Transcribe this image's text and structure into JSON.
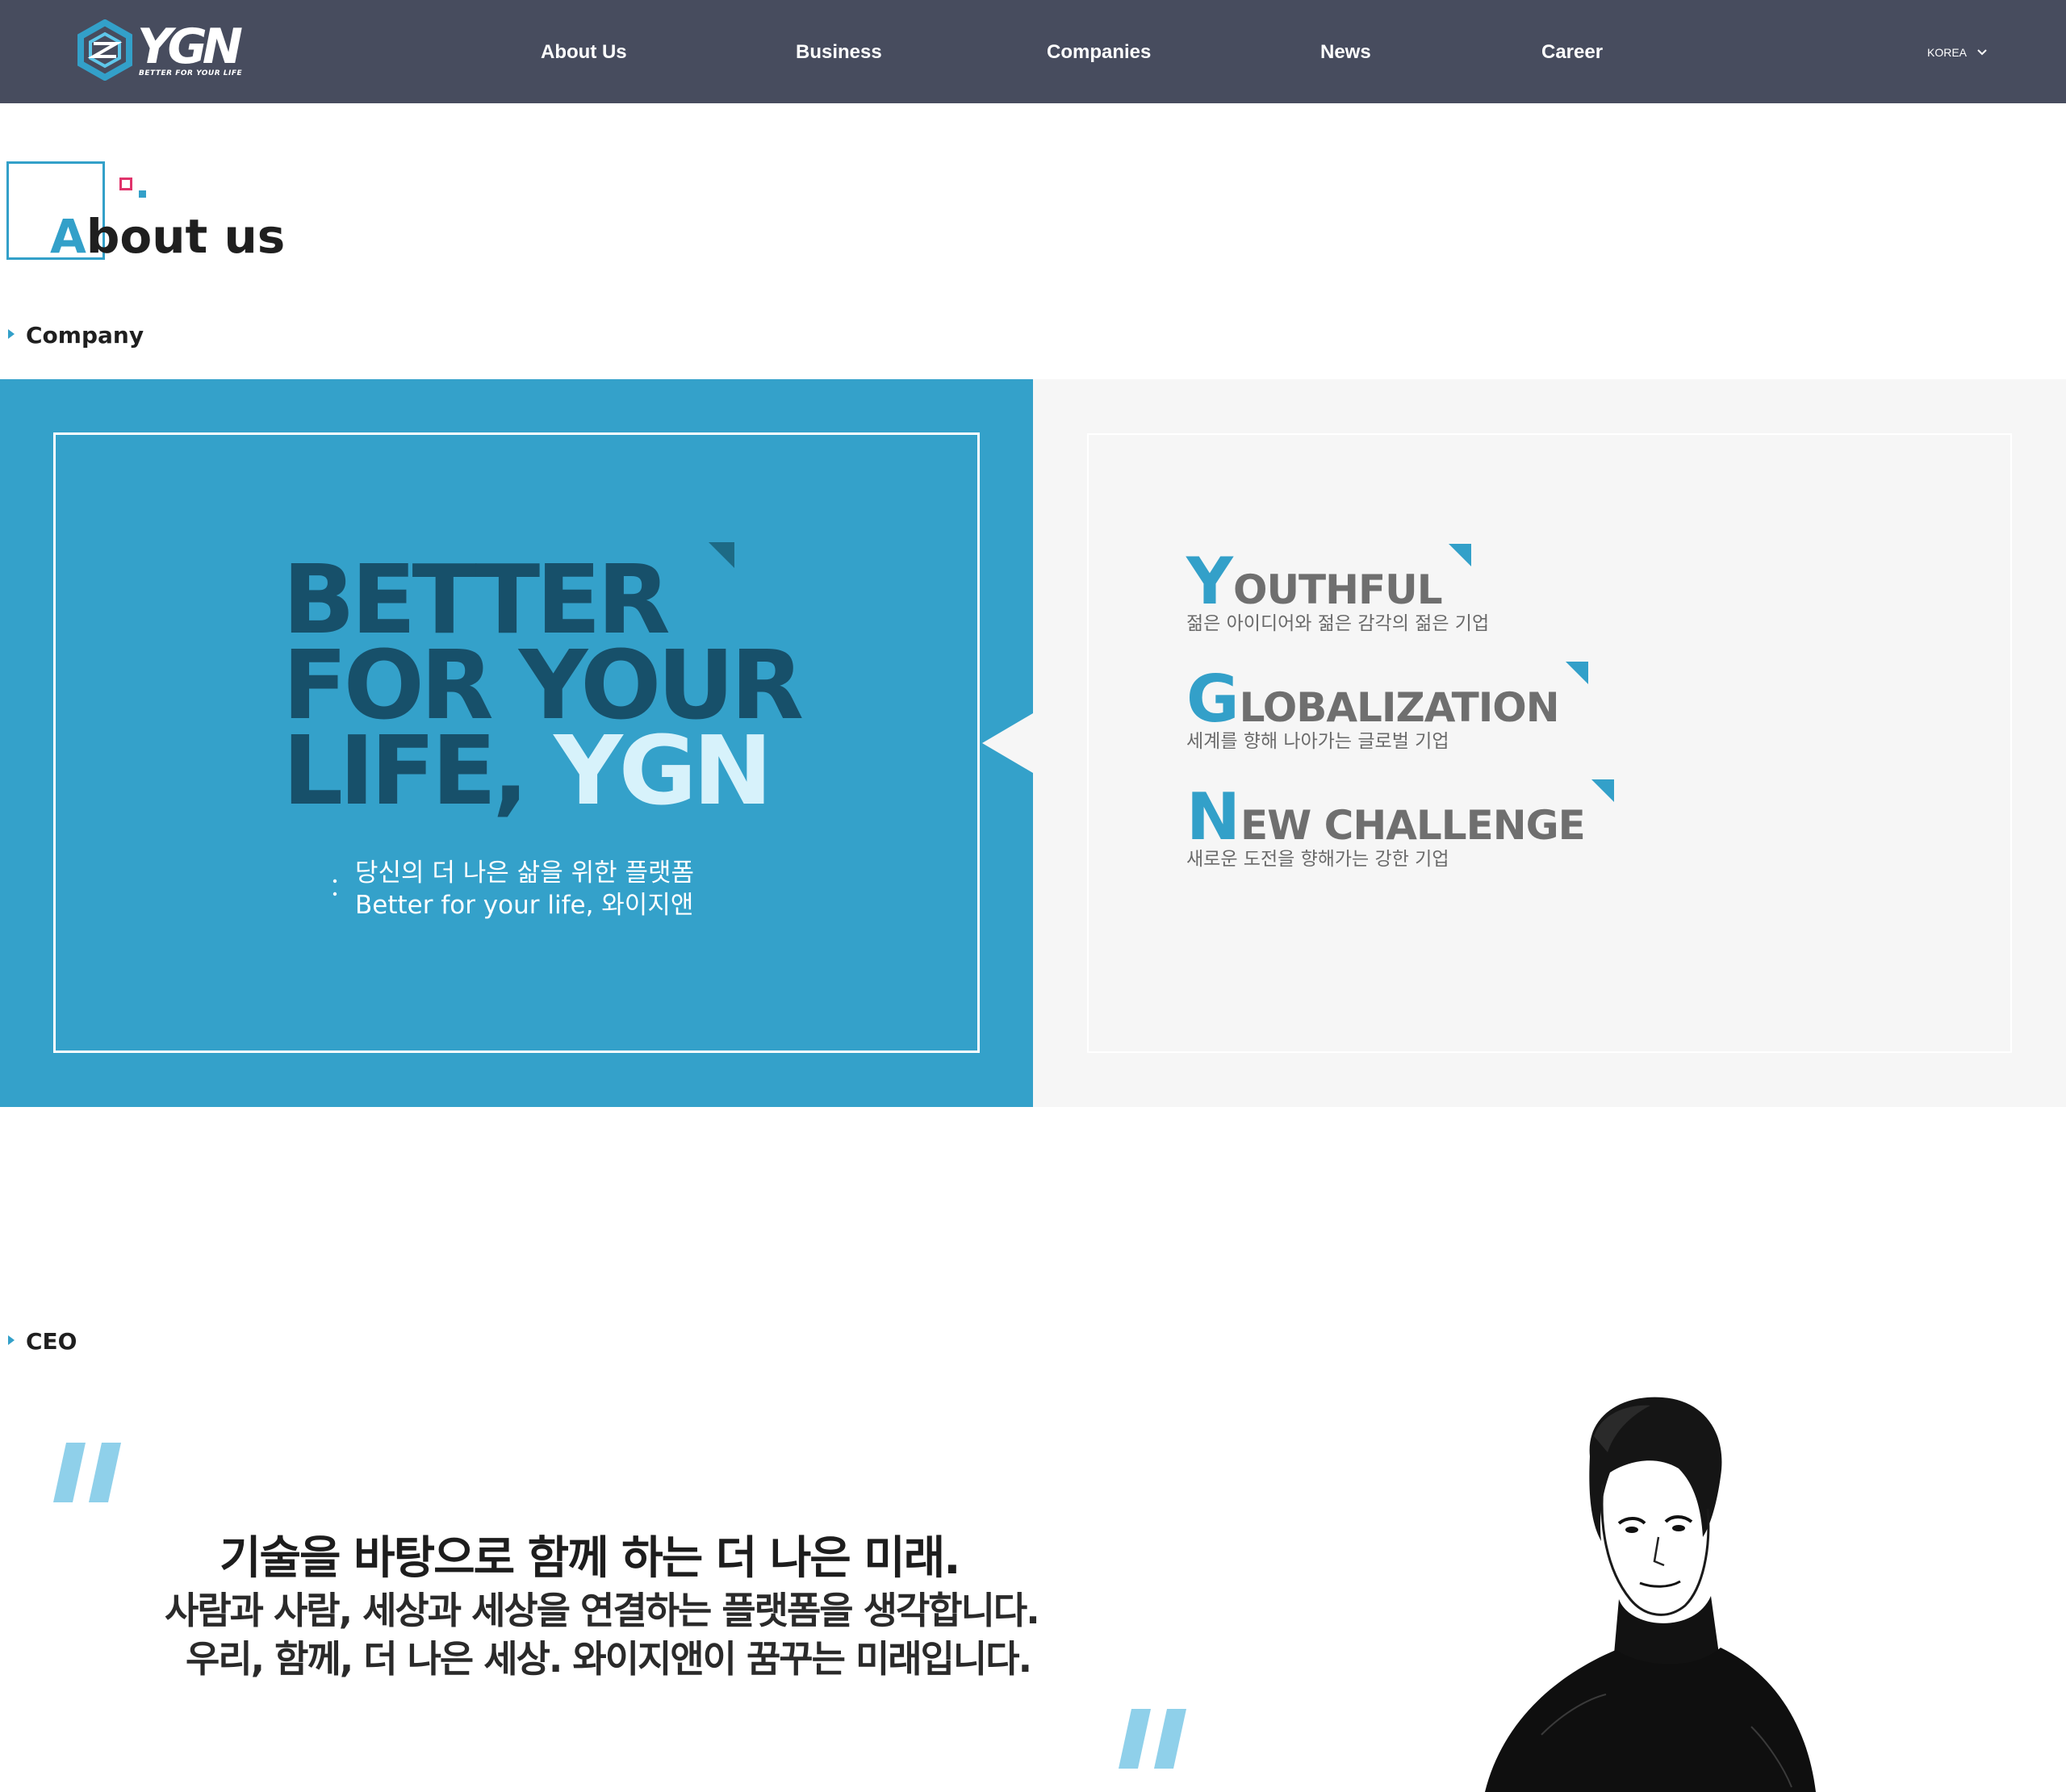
{
  "header": {
    "logo_text": "YGN",
    "logo_tagline": "BETTER FOR YOUR LIFE",
    "nav": [
      {
        "label": "About Us"
      },
      {
        "label": "Business"
      },
      {
        "label": "Companies"
      },
      {
        "label": "News"
      },
      {
        "label": "Career"
      }
    ],
    "language": "KOREA"
  },
  "about": {
    "title_first_letter": "A",
    "title_rest": "bout us"
  },
  "company": {
    "section_label": "Company",
    "slogan": {
      "line1": "BETTER",
      "line2": "FOR YOUR",
      "line3_a": "LIFE, ",
      "line3_b": "YGN"
    },
    "subtitle_ko": "당신의 더 나은 삶을 위한 플랫폼",
    "subtitle_en": "Better for your life, 와이지앤",
    "values": [
      {
        "cap": "Y",
        "rest": "OUTHFUL",
        "desc": "젊은 아이디어와 젊은 감각의 젊은 기업"
      },
      {
        "cap": "G",
        "rest": "LOBALIZATION",
        "desc": "세계를 향해 나아가는 글로벌 기업"
      },
      {
        "cap": "N",
        "rest": "EW CHALLENGE",
        "desc": "새로운 도전을 향해가는 강한 기업"
      }
    ]
  },
  "ceo": {
    "section_label": "CEO",
    "quote_lines": [
      "기술을 바탕으로 함께 하는 더 나은 미래.",
      "사람과 사람, 세상과 세상을 연결하는 플랫폼을 생각합니다.",
      "우리, 함께, 더 나은 세상. 와이지앤이 꿈꾸는 미래입니다."
    ]
  },
  "colors": {
    "header_bg": "#474c5e",
    "accent_blue": "#34a1ca",
    "accent_pink": "#e0336b",
    "panel_grey": "#f6f6f6",
    "slogan_dark": "#17506a",
    "slogan_light": "#d7f2fb"
  }
}
